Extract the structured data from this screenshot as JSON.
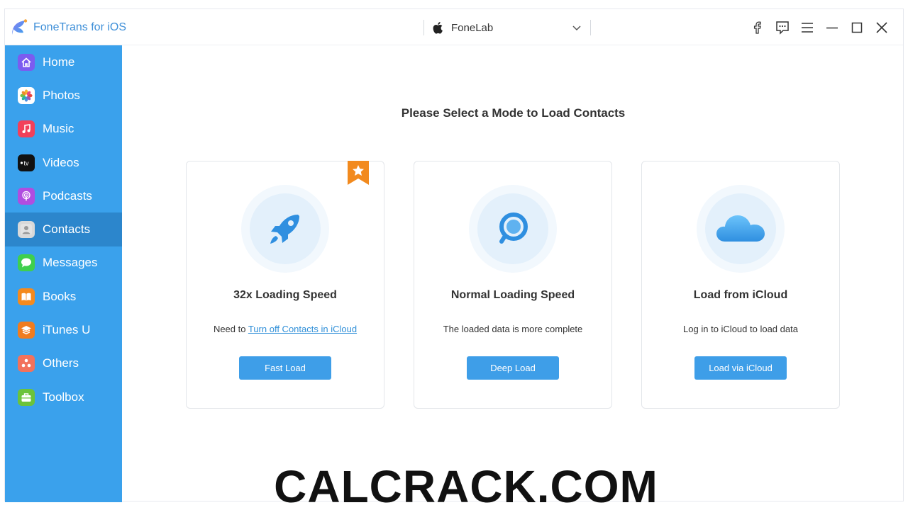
{
  "app": {
    "title": "FoneTrans for iOS"
  },
  "device": {
    "name": "FoneLab"
  },
  "sidebar": {
    "items": [
      {
        "label": "Home",
        "icon": "home-icon"
      },
      {
        "label": "Photos",
        "icon": "photos-icon"
      },
      {
        "label": "Music",
        "icon": "music-icon"
      },
      {
        "label": "Videos",
        "icon": "videos-icon"
      },
      {
        "label": "Podcasts",
        "icon": "podcasts-icon"
      },
      {
        "label": "Contacts",
        "icon": "contacts-icon",
        "active": true
      },
      {
        "label": "Messages",
        "icon": "messages-icon"
      },
      {
        "label": "Books",
        "icon": "books-icon"
      },
      {
        "label": "iTunes U",
        "icon": "itunes-u-icon"
      },
      {
        "label": "Others",
        "icon": "others-icon"
      },
      {
        "label": "Toolbox",
        "icon": "toolbox-icon"
      }
    ]
  },
  "main": {
    "heading": "Please Select a Mode to Load Contacts",
    "cards": [
      {
        "title": "32x Loading Speed",
        "desc_prefix": "Need to ",
        "desc_link": "Turn off Contacts in iCloud",
        "button": "Fast Load",
        "icon": "rocket-icon",
        "badge": "star-ribbon-icon"
      },
      {
        "title": "Normal Loading Speed",
        "desc": "The loaded data is more complete",
        "button": "Deep Load",
        "icon": "magnifier-icon"
      },
      {
        "title": "Load from iCloud",
        "desc": "Log in to iCloud to load data",
        "button": "Load via iCloud",
        "icon": "icloud-icon"
      }
    ]
  },
  "watermark": "CALCRACK.COM",
  "colors": {
    "sidebar": "#3aa1ec",
    "sidebar_active": "#2c86cc",
    "button": "#3e9ee8",
    "brand_text": "#3e8fd8",
    "ribbon": "#f28a1e"
  }
}
